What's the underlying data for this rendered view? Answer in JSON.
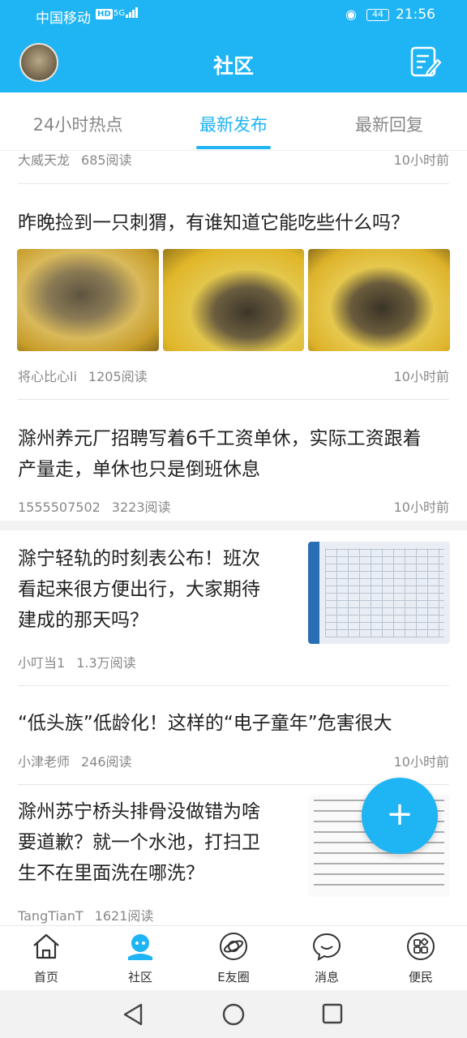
{
  "status_bar": {
    "carrier": "中国移动",
    "network_badge": "HD",
    "signal_label": "5G",
    "battery": "44",
    "time": "21:56"
  },
  "header": {
    "title": "社区"
  },
  "tabs": [
    {
      "label": "24小时热点"
    },
    {
      "label": "最新发布"
    },
    {
      "label": "最新回复"
    }
  ],
  "active_tab": "最新发布",
  "posts": [
    {
      "author": "大威天龙",
      "reads": "685阅读",
      "time": "10小时前"
    },
    {
      "title": "昨晚捡到一只刺猬，有谁知道它能吃些什么吗？",
      "author": "将心比心li",
      "reads": "1205阅读",
      "time": "10小时前"
    },
    {
      "title_line1": "滁州养元厂招聘写着6千工资单休，实际工资跟着",
      "title_line2": "产量走，单休也只是倒班休息",
      "author": "1555507502",
      "reads": "3223阅读",
      "time": "10小时前"
    },
    {
      "title_line1": "滁宁轻轨的时刻表公布！班次",
      "title_line2": "看起来很方便出行，大家期待",
      "title_line3": "建成的那天吗？",
      "author": "小叮当1",
      "reads": "1.3万阅读"
    },
    {
      "title": "“低头族”低龄化！这样的“电子童年”危害很大",
      "author": "小津老师",
      "reads": "246阅读",
      "time": "10小时前"
    },
    {
      "title_line1": "滁州苏宁桥头排骨没做错为啥",
      "title_line2": "要道歉？就一个水池，打扫卫",
      "title_line3": "生不在里面洗在哪洗？",
      "author": "TangTianT",
      "reads": "1621阅读"
    }
  ],
  "fab": {
    "icon": "plus-icon",
    "label": "+"
  },
  "bottom_nav": [
    {
      "label": "首页",
      "icon": "home-icon"
    },
    {
      "label": "社区",
      "icon": "community-icon",
      "active": true
    },
    {
      "label": "E友圈",
      "icon": "planet-icon"
    },
    {
      "label": "消息",
      "icon": "message-icon"
    },
    {
      "label": "便民",
      "icon": "services-icon"
    }
  ],
  "colors": {
    "accent": "#1fb4f4",
    "text": "#222222",
    "meta": "#888888"
  }
}
